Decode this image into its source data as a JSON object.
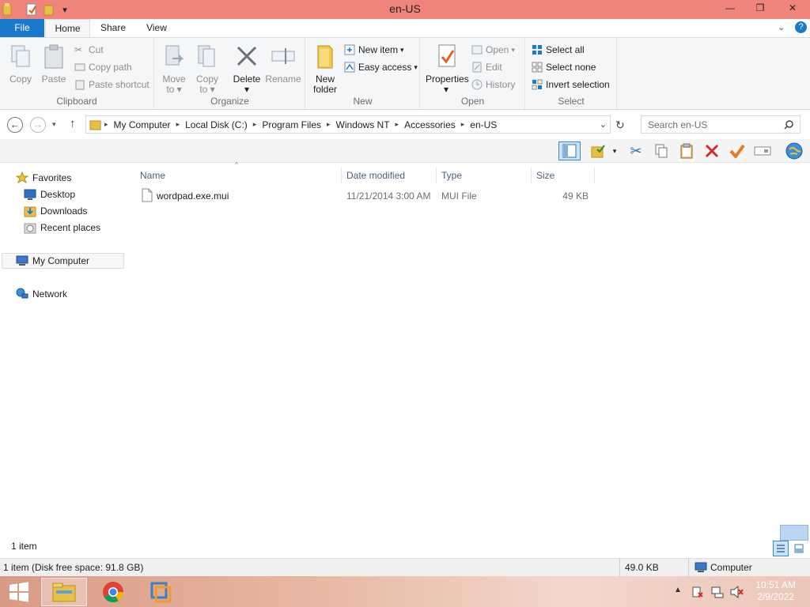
{
  "window": {
    "title": "en-US",
    "minimize": "—",
    "maximize": "❐",
    "close": "✕",
    "qat_dropdown": "▾"
  },
  "ribbon_tabs": {
    "file": "File",
    "home": "Home",
    "share": "Share",
    "view": "View"
  },
  "ribbon": {
    "clipboard": {
      "copy": "Copy",
      "paste": "Paste",
      "cut": "Cut",
      "copy_path": "Copy path",
      "paste_shortcut": "Paste shortcut",
      "label": "Clipboard"
    },
    "organize": {
      "move_to": "Move",
      "move_to_2": "to",
      "copy_to": "Copy",
      "copy_to_2": "to",
      "delete": "Delete",
      "rename": "Rename",
      "label": "Organize"
    },
    "new": {
      "new_folder": "New",
      "new_folder_2": "folder",
      "new_item": "New item",
      "easy_access": "Easy access",
      "label": "New"
    },
    "open": {
      "properties": "Properties",
      "open": "Open",
      "edit": "Edit",
      "history": "History",
      "label": "Open"
    },
    "select": {
      "select_all": "Select all",
      "select_none": "Select none",
      "invert_selection": "Invert selection",
      "label": "Select"
    }
  },
  "address": {
    "breadcrumb": [
      "My Computer",
      "Local Disk (C:)",
      "Program Files",
      "Windows NT",
      "Accessories",
      "en-US"
    ],
    "search_placeholder": "Search en-US"
  },
  "nav": {
    "favorites": "Favorites",
    "desktop": "Desktop",
    "downloads": "Downloads",
    "recent": "Recent places",
    "computer": "My Computer",
    "network": "Network"
  },
  "columns": {
    "name": "Name",
    "date": "Date modified",
    "type": "Type",
    "size": "Size"
  },
  "files": [
    {
      "name": "wordpad.exe.mui",
      "date": "11/21/2014 3:00 AM",
      "type": "MUI File",
      "size": "49 KB"
    }
  ],
  "status": {
    "item_count": "1 item",
    "disk_info": "1 item (Disk free space: 91.8 GB)",
    "size": "49.0 KB",
    "location": "Computer"
  },
  "taskbar": {
    "time": "10:51 AM",
    "date": "2/9/2022"
  },
  "colors": {
    "titlebar": "#f0847a",
    "file_tab": "#1979ca",
    "accent": "#1979ca"
  }
}
